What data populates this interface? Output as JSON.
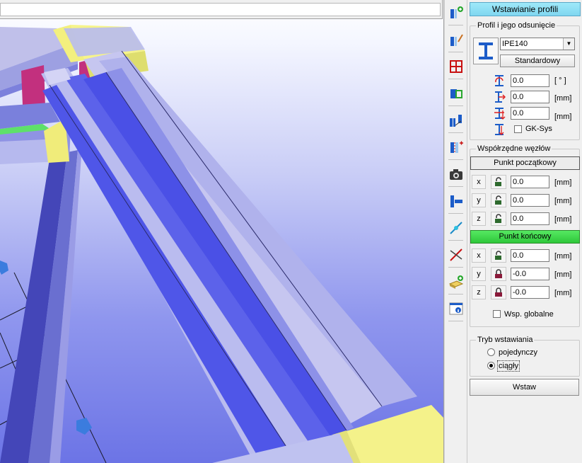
{
  "viewport": {
    "name": "3d-model-view"
  },
  "toolbar": {
    "icons": [
      "insert-profile-icon",
      "edit-profile-icon",
      "grid-icon",
      "connect-icon",
      "place-profile-icon",
      "split-profile-icon",
      "camera-icon",
      "profile-end-icon",
      "measure-icon",
      "cut-icon",
      "add-plate-icon",
      "info-icon"
    ]
  },
  "panel": {
    "title": "Wstawianie profili",
    "profile_group": {
      "label": "Profil i jego odsunięcie",
      "profile_select": "IPE140",
      "standard_button": "Standardowy",
      "rotation_value": "0.0",
      "rotation_unit": "[ ° ]",
      "offset1_value": "0.0",
      "offset1_unit": "[mm]",
      "offset2_value": "0.0",
      "offset2_unit": "[mm]",
      "gk_sys_label": "GK-Sys"
    },
    "nodes_group": {
      "label": "Współrzędne węzłów",
      "start_button": "Punkt początkowy",
      "start": [
        {
          "axis": "x",
          "value": "0.0",
          "unit": "[mm]",
          "locked": false
        },
        {
          "axis": "y",
          "value": "0.0",
          "unit": "[mm]",
          "locked": false
        },
        {
          "axis": "z",
          "value": "0.0",
          "unit": "[mm]",
          "locked": false
        }
      ],
      "end_button": "Punkt końcowy",
      "end": [
        {
          "axis": "x",
          "value": "0.0",
          "unit": "[mm]",
          "locked": false
        },
        {
          "axis": "y",
          "value": "-0.0",
          "unit": "[mm]",
          "locked": true
        },
        {
          "axis": "z",
          "value": "-0.0",
          "unit": "[mm]",
          "locked": true
        }
      ],
      "global_label": "Wsp. globalne"
    },
    "mode_group": {
      "label": "Tryb wstawiania",
      "options": [
        "pojedynczy",
        "ciągły"
      ],
      "selected": "ciągły"
    },
    "insert_button": "Wstaw"
  },
  "colors": {
    "title_bar": "#8fe0f5",
    "start_button": "#ececec",
    "end_button": "#3ad84a",
    "beam_face": "#c8c8f0",
    "beam_web": "#4e55e8",
    "plate": "#f2f07a"
  }
}
